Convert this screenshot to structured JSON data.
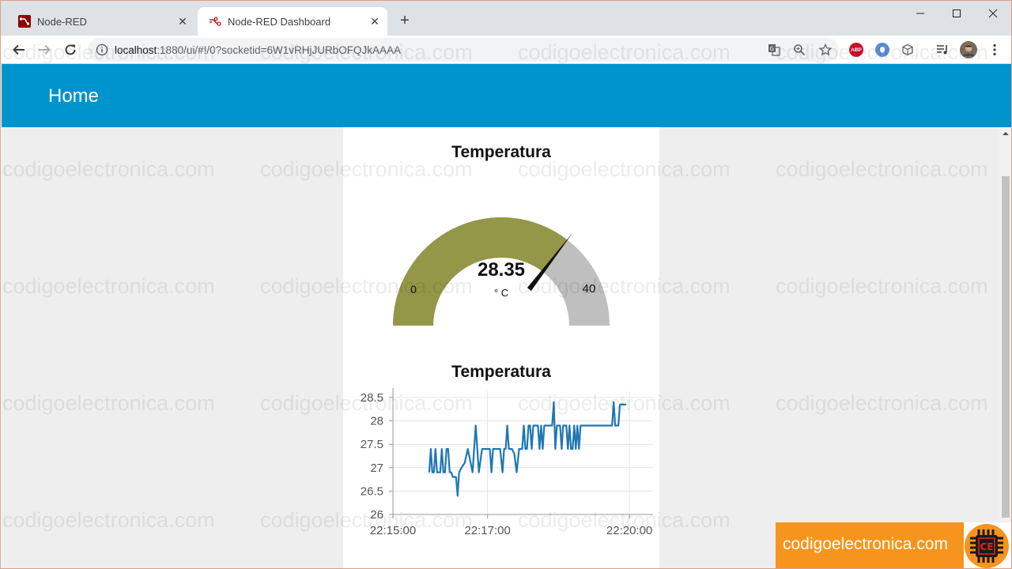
{
  "browser": {
    "tabs": [
      {
        "title": "Node-RED",
        "active": false
      },
      {
        "title": "Node-RED Dashboard",
        "active": true
      }
    ],
    "url_host": "localhost",
    "url_rest": ":1880/ui/#!/0?socketid=6W1vRHjJURbOFQJkAAAA",
    "extensions": [
      "ABP"
    ]
  },
  "dashboard": {
    "header_title": "Home",
    "gauge": {
      "title": "Temperatura",
      "value": 28.35,
      "value_text": "28.35",
      "units": "° C",
      "min": 0,
      "max": 40,
      "min_label": "0",
      "max_label": "40",
      "fill_color": "#949747",
      "track_color": "#bfbfbf"
    },
    "chart_title": "Temperatura"
  },
  "chart_data": {
    "type": "line",
    "title": "Temperatura",
    "xlabel": "",
    "ylabel": "",
    "ylim": [
      26,
      28.5
    ],
    "yticks": [
      "28.5",
      "28",
      "27.5",
      "27",
      "26.5",
      "26"
    ],
    "xticks": [
      {
        "t": "22:15:00",
        "label": "22:15:00"
      },
      {
        "t": "22:17:00",
        "label": "22:17:00"
      },
      {
        "t": "22:20:00",
        "label": "22:20:00"
      }
    ],
    "xlim": [
      "22:15:00",
      "22:20:30"
    ],
    "grid": true,
    "color": "#1f77b4",
    "x": [
      "22:15:46",
      "22:15:48",
      "22:15:50",
      "22:15:52",
      "22:15:54",
      "22:15:56",
      "22:15:58",
      "22:16:00",
      "22:16:02",
      "22:16:04",
      "22:16:06",
      "22:16:08",
      "22:16:10",
      "22:16:12",
      "22:16:14",
      "22:16:16",
      "22:16:18",
      "22:16:20",
      "22:16:22",
      "22:16:24",
      "22:16:27",
      "22:16:31",
      "22:16:35",
      "22:16:41",
      "22:16:45",
      "22:16:49",
      "22:16:53",
      "22:16:55",
      "22:16:57",
      "22:16:59",
      "22:17:01",
      "22:17:03",
      "22:17:05",
      "22:17:07",
      "22:17:10",
      "22:17:13",
      "22:17:16",
      "22:17:19",
      "22:17:21",
      "22:17:23",
      "22:17:25",
      "22:17:27",
      "22:17:29",
      "22:17:31",
      "22:17:34",
      "22:17:37",
      "22:17:40",
      "22:17:42",
      "22:17:44",
      "22:17:46",
      "22:17:48",
      "22:17:50",
      "22:17:52",
      "22:17:54",
      "22:17:56",
      "22:17:58",
      "22:18:00",
      "22:18:02",
      "22:18:04",
      "22:18:06",
      "22:18:08",
      "22:18:10",
      "22:18:12",
      "22:18:14",
      "22:18:16",
      "22:18:18",
      "22:18:20",
      "22:18:22",
      "22:18:24",
      "22:18:26",
      "22:18:28",
      "22:18:30",
      "22:18:32",
      "22:18:34",
      "22:18:36",
      "22:18:38",
      "22:18:40",
      "22:18:42",
      "22:18:44",
      "22:18:46",
      "22:18:48",
      "22:18:50",
      "22:18:52",
      "22:18:54",
      "22:18:56",
      "22:18:58",
      "22:19:00",
      "22:19:02",
      "22:19:04",
      "22:19:06",
      "22:19:08",
      "22:19:10",
      "22:19:12",
      "22:19:14",
      "22:19:16",
      "22:19:18",
      "22:19:20",
      "22:19:22",
      "22:19:24",
      "22:19:26",
      "22:19:28",
      "22:19:30",
      "22:19:32",
      "22:19:34",
      "22:19:36",
      "22:19:38",
      "22:19:40",
      "22:19:42",
      "22:19:44",
      "22:19:46",
      "22:19:48",
      "22:19:50",
      "22:19:52",
      "22:19:54",
      "22:19:56"
    ],
    "series": [
      {
        "values": [
          26.9,
          27.4,
          26.9,
          26.9,
          27.4,
          26.9,
          26.9,
          26.9,
          27.4,
          26.9,
          26.9,
          27.4,
          27.4,
          26.9,
          26.9,
          26.8,
          26.8,
          26.8,
          26.4,
          26.9,
          27.0,
          27.1,
          27.4,
          26.9,
          27.9,
          26.9,
          27.4,
          27.4,
          27.4,
          27.4,
          27.4,
          27.4,
          26.9,
          27.4,
          27.4,
          27.4,
          27.4,
          26.9,
          27.4,
          27.4,
          27.9,
          27.4,
          27.4,
          27.4,
          27.3,
          26.9,
          27.4,
          27.4,
          27.4,
          27.9,
          27.4,
          27.4,
          27.9,
          27.9,
          27.4,
          27.9,
          27.9,
          27.9,
          27.9,
          27.4,
          27.9,
          27.4,
          27.9,
          27.9,
          27.9,
          27.9,
          27.9,
          27.9,
          28.4,
          27.4,
          27.9,
          27.9,
          27.9,
          27.4,
          27.9,
          27.9,
          27.9,
          27.4,
          27.9,
          27.4,
          27.4,
          27.9,
          27.4,
          27.9,
          27.4,
          27.9,
          27.9,
          27.9,
          27.9,
          27.9,
          27.9,
          27.9,
          27.9,
          27.9,
          27.9,
          27.9,
          27.9,
          27.9,
          27.9,
          27.9,
          27.9,
          27.9,
          27.9,
          27.9,
          27.9,
          27.9,
          28.4,
          27.9,
          27.9,
          27.9,
          28.35,
          28.35,
          28.35,
          28.35,
          28.35
        ]
      }
    ]
  },
  "branding": {
    "watermark": "codigoelectronica.com",
    "badge_text": "codigoelectronica.com",
    "logo_letters": "CE",
    "accent": "#f7941d"
  }
}
